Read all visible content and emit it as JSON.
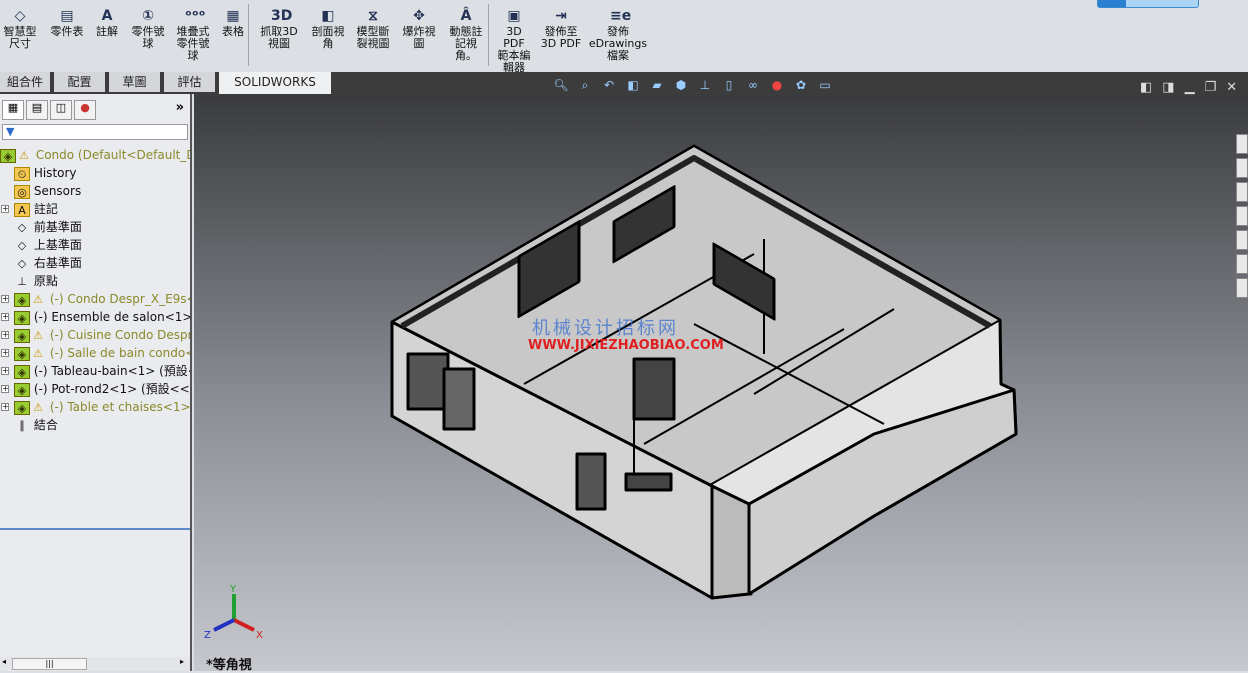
{
  "toolbar": {
    "buttons": [
      {
        "label": "智慧型\n尺寸",
        "icon": "smart-dimension-icon",
        "glyph": "◇"
      },
      {
        "label": "零件表",
        "icon": "bom-icon",
        "glyph": "▤"
      },
      {
        "label": "註解",
        "icon": "note-icon",
        "glyph": "A"
      },
      {
        "label": "零件號\n球",
        "icon": "balloon-icon",
        "glyph": "①"
      },
      {
        "label": "堆疊式\n零件號\n球",
        "icon": "stacked-balloon-icon",
        "glyph": "ᵒᵒᵒ"
      },
      {
        "label": "表格",
        "icon": "table-icon",
        "glyph": "▦"
      },
      {
        "label": "抓取3D\n視圖",
        "icon": "capture-3d-view-icon",
        "glyph": "3D"
      },
      {
        "label": "剖面視\n角",
        "icon": "section-view-icon",
        "glyph": "◧"
      },
      {
        "label": "模型斷\n裂視圖",
        "icon": "model-break-view-icon",
        "glyph": "⧖"
      },
      {
        "label": "爆炸視\n圖",
        "icon": "exploded-view-icon",
        "glyph": "✥"
      },
      {
        "label": "動態註\n記視\n角。",
        "icon": "dynamic-annotation-icon",
        "glyph": "Â"
      },
      {
        "label": "3D PDF\n範本編\n輯器",
        "icon": "pdf-template-icon",
        "glyph": "▣"
      },
      {
        "label": "發佈至\n3D PDF",
        "icon": "publish-3d-pdf-icon",
        "glyph": "⇥"
      },
      {
        "label": "發佈\neDrawings\n檔案",
        "icon": "edrawings-icon",
        "glyph": "≡e"
      }
    ]
  },
  "tabs": [
    "組合件",
    "配置",
    "草圖",
    "評估",
    "SOLIDWORKS MBD"
  ],
  "active_tab": "SOLIDWORKS MBD",
  "panel": {
    "collapse": "»",
    "filter": "▼"
  },
  "tree": [
    {
      "label": "Condo  (Default<Default_D",
      "icon": "assembly-icon",
      "warn": true,
      "exp": false,
      "indent": 0
    },
    {
      "label": "History",
      "icon": "history-icon",
      "exp": false,
      "indent": 1
    },
    {
      "label": "Sensors",
      "icon": "sensors-icon",
      "exp": false,
      "indent": 1
    },
    {
      "label": "註記",
      "icon": "annotations-icon",
      "exp": true,
      "indent": 1
    },
    {
      "label": "前基準面",
      "icon": "plane-icon",
      "exp": false,
      "indent": 1
    },
    {
      "label": "上基準面",
      "icon": "plane-icon",
      "exp": false,
      "indent": 1
    },
    {
      "label": "右基準面",
      "icon": "plane-icon",
      "exp": false,
      "indent": 1
    },
    {
      "label": "原點",
      "icon": "origin-icon",
      "exp": false,
      "indent": 1
    },
    {
      "label": "(-) Condo Despr_X_E9s<",
      "icon": "assembly-icon",
      "warn": true,
      "exp": true,
      "indent": 1
    },
    {
      "label": "(-) Ensemble de salon<1> (",
      "icon": "assembly-icon",
      "exp": true,
      "indent": 1
    },
    {
      "label": "(-) Cuisine Condo Despr_",
      "icon": "assembly-icon",
      "warn": true,
      "exp": true,
      "indent": 1
    },
    {
      "label": "(-) Salle de bain condo<",
      "icon": "assembly-icon",
      "warn": true,
      "exp": true,
      "indent": 1
    },
    {
      "label": "(-) Tableau-bain<1> (預設<",
      "icon": "part-group-icon",
      "exp": true,
      "indent": 1
    },
    {
      "label": "(-) Pot-rond2<1> (預設<<預",
      "icon": "part-group-icon",
      "exp": true,
      "indent": 1
    },
    {
      "label": "(-) Table et chaises<1> (",
      "icon": "assembly-icon",
      "warn": true,
      "exp": true,
      "indent": 1
    },
    {
      "label": "結合",
      "icon": "mates-icon",
      "exp": false,
      "indent": 1
    }
  ],
  "viewport": {
    "view_name": "*等角視",
    "watermark_cn": "机械设计招标网",
    "watermark_url": "WWW.JIXIEZHAOBIAO.COM",
    "triad": {
      "x": "X",
      "y": "Y",
      "z": "Z"
    }
  },
  "colors": {
    "x_axis": "#d02020",
    "y_axis": "#20a030",
    "z_axis": "#2030c0",
    "warning": "#c8a000"
  }
}
